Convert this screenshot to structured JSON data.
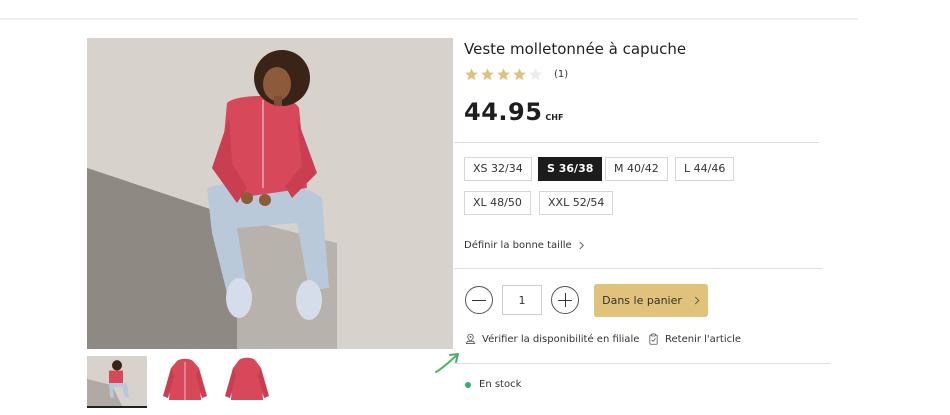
{
  "product": {
    "title": "Veste molletonnée à capuche",
    "rating": {
      "value": 4,
      "max": 5,
      "review_count": "(1)"
    },
    "price": {
      "amount": "44.95",
      "currency": "CHF"
    }
  },
  "sizes": [
    {
      "label": "XS 32/34",
      "selected": false
    },
    {
      "label": "S 36/38",
      "selected": true
    },
    {
      "label": "M 40/42",
      "selected": false
    },
    {
      "label": "L 44/46",
      "selected": false
    },
    {
      "label": "XL 48/50",
      "selected": false
    },
    {
      "label": "XXL 52/54",
      "selected": false
    }
  ],
  "size_guide_label": "Définir la bonne taille",
  "quantity": "1",
  "cart_button_label": "Dans le panier",
  "links": {
    "availability": "Vérifier la disponibilité en filiale",
    "return": "Retenir l'article"
  },
  "stock_status": "En stock",
  "colors": {
    "accent": "#e1c27a",
    "star": "#e0c27c",
    "star_empty": "#ececec",
    "stock_dot": "#2fb36b",
    "selected_size": "#1c1c1c",
    "jacket": "#d6485a",
    "annotation_arrow": "#4caf6a"
  },
  "icons": {
    "availability": "store-location-icon",
    "return": "clipboard-icon",
    "minus": "minus-icon",
    "plus": "plus-icon",
    "chevron": "chevron-right-icon"
  }
}
